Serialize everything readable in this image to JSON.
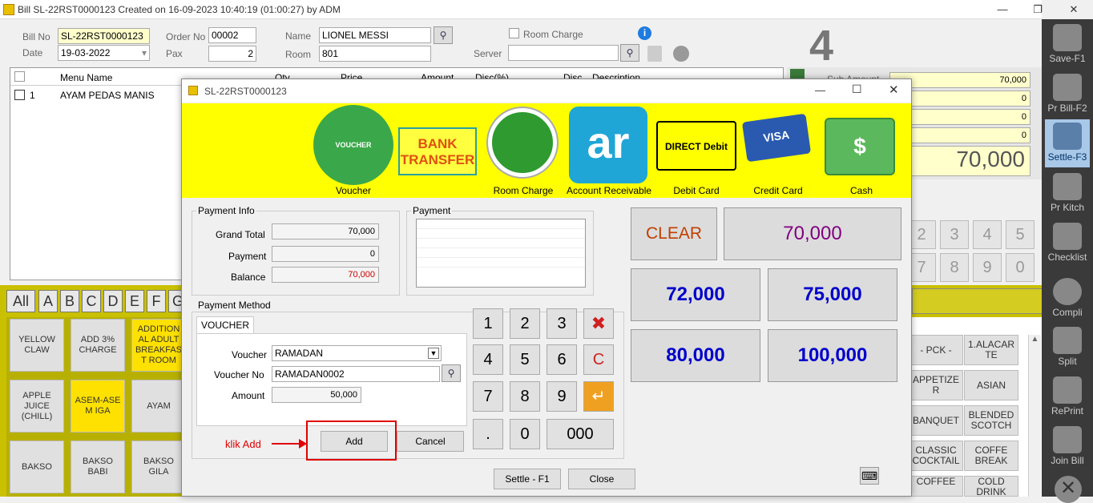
{
  "window": {
    "title": "Bill SL-22RST0000123 Created on 16-09-2023 10:40:19 (01:00:27) by ADM"
  },
  "header": {
    "bill_no_label": "Bill No",
    "bill_no": "SL-22RST0000123",
    "date_label": "Date",
    "date": "19-03-2022",
    "order_no_label": "Order No",
    "order_no": "00002",
    "pax_label": "Pax",
    "pax": "2",
    "name_label": "Name",
    "name": "LIONEL MESSI",
    "room_label": "Room",
    "room": "801",
    "room_charge_label": "Room Charge",
    "server_label": "Server",
    "server": "",
    "table_number": "4"
  },
  "order_grid": {
    "columns": [
      "Menu Name",
      "Qty",
      "Price",
      "Amount",
      "Disc(%)",
      "Disc",
      "Description"
    ],
    "rows": [
      {
        "no": "1",
        "name": "AYAM PEDAS MANIS"
      }
    ]
  },
  "totals": {
    "sub_amount_label": "Sub Amount",
    "sub_amount": "70,000",
    "v1": "0",
    "v2": "0",
    "v3": "0",
    "total": "70,000"
  },
  "bg_numpad": [
    "2",
    "3",
    "4",
    "5",
    "7",
    "8",
    "9",
    "0"
  ],
  "letters": [
    "All",
    "A",
    "B",
    "C",
    "D",
    "E",
    "F",
    "G"
  ],
  "menu_items": [
    "YELLOW CLAW",
    "ADD 3% CHARGE",
    "ADDITION AL ADULT BREAKFAS T ROOM",
    "APPLE JUICE (CHILL)",
    "ASEM-ASE M IGA",
    "AYAM",
    "BAKSO",
    "BAKSO BABI",
    "BAKSO GILA"
  ],
  "categories": [
    "- PCK -",
    "1.ALACAR TE",
    "APPETIZE R",
    "ASIAN",
    "BANQUET",
    "BLENDED SCOTCH",
    "CLASSIC COCKTAIL",
    "COFFE BREAK",
    "COFFEE",
    "COLD DRINK"
  ],
  "sidebar": [
    {
      "label": "Save-F1",
      "icon": "floppy-icon"
    },
    {
      "label": "Pr Bill-F2",
      "icon": "printer-icon"
    },
    {
      "label": "Settle-F3",
      "icon": "money-icon"
    },
    {
      "label": "Pr Kitch",
      "icon": "chef-icon"
    },
    {
      "label": "Checklist",
      "icon": "checklist-icon"
    },
    {
      "label": "Compli",
      "icon": "free-badge-icon"
    },
    {
      "label": "Split",
      "icon": "split-icon"
    },
    {
      "label": "RePrint",
      "icon": "reprint-icon"
    },
    {
      "label": "Join Bill",
      "icon": "join-icon"
    }
  ],
  "dialog": {
    "title": "SL-22RST0000123",
    "payment_methods": [
      {
        "label": "Voucher",
        "icon": "voucher-icon",
        "inner": "VOUCHER"
      },
      {
        "label": "",
        "icon": "bank-transfer-icon",
        "inner": "BANK TRANSFER"
      },
      {
        "label": "Room Charge",
        "icon": "bed-icon"
      },
      {
        "label": "Account Receivable",
        "icon": "ar-icon",
        "inner": "ar"
      },
      {
        "label": "Debit Card",
        "icon": "direct-debit-icon",
        "inner": "DIRECT Debit"
      },
      {
        "label": "Credit Card",
        "icon": "credit-card-icon",
        "inner": "VISA"
      },
      {
        "label": "Cash",
        "icon": "cash-icon"
      }
    ],
    "payment_info": {
      "legend": "Payment Info",
      "grand_total_label": "Grand Total",
      "grand_total": "70,000",
      "payment_label": "Payment",
      "payment": "0",
      "balance_label": "Balance",
      "balance": "70,000"
    },
    "payment_legend": "Payment",
    "payment_method": {
      "legend": "Payment Method",
      "tab": "VOUCHER",
      "voucher_label": "Voucher",
      "voucher": "RAMADAN",
      "voucher_no_label": "Voucher No",
      "voucher_no": "RAMADAN0002",
      "amount_label": "Amount",
      "amount": "50,000",
      "add": "Add",
      "cancel": "Cancel"
    },
    "annotation": "klik Add",
    "keypad": [
      "1",
      "2",
      "3",
      "4",
      "5",
      "6",
      "7",
      "8",
      "9",
      ".",
      "0",
      "000"
    ],
    "clear_key": "C",
    "clear": "CLEAR",
    "quick_amounts": [
      "70,000",
      "72,000",
      "75,000",
      "80,000",
      "100,000"
    ],
    "settle": "Settle - F1",
    "close": "Close",
    "colors": {
      "banner": "#ffff00",
      "quick_blue": "#0000cc",
      "quick_purple": "#800080",
      "clear_red": "#c04000",
      "annotation": "#e00000"
    }
  }
}
